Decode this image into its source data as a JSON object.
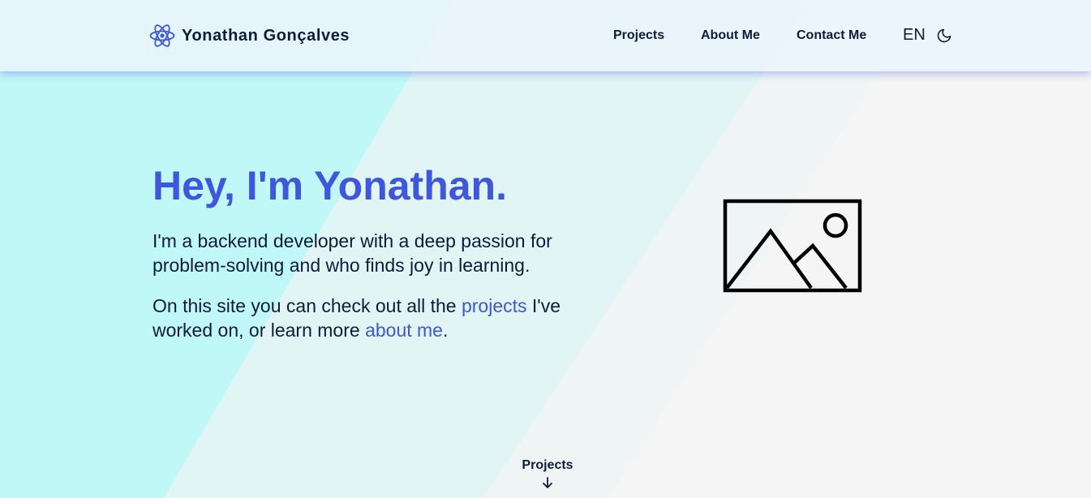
{
  "header": {
    "brand_name": "Yonathan Gonçalves",
    "brand_icon": "atom-icon",
    "nav": {
      "projects": "Projects",
      "about": "About Me",
      "contact": "Contact Me"
    },
    "language": "EN",
    "theme_icon": "moon-icon"
  },
  "hero": {
    "title": "Hey, I'm Yonathan.",
    "intro": "I'm a backend developer with a deep passion for problem-solving and who finds joy in learning.",
    "site_text_before": "On this site you can check out all the ",
    "projects_link": "projects",
    "site_text_middle": " I've worked on, or learn more ",
    "about_link": "about me",
    "site_text_after": ".",
    "image_icon": "image-placeholder-icon"
  },
  "scroll": {
    "label": "Projects",
    "icon": "arrow-down-icon"
  },
  "colors": {
    "accent": "#3f57e0",
    "text": "#0f1b3d",
    "cyan_band": "#c0f7f7",
    "mid_band": "#e0f5f4",
    "background": "#f4f5f4"
  }
}
